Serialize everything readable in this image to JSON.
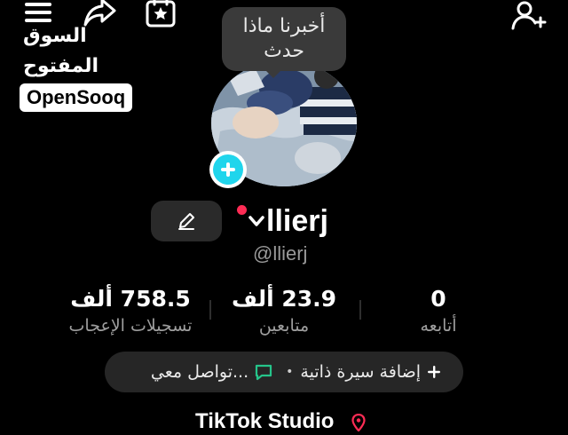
{
  "header": {
    "icons": [
      "menu-icon",
      "share-icon",
      "calendar-star-icon",
      "add-user-icon"
    ]
  },
  "watermark": {
    "arabic_name": "السوق المفتوح",
    "brand": "OpenSooq"
  },
  "bubble": {
    "line1": "أخبرنا ماذا",
    "line2": "حدث"
  },
  "profile": {
    "display_name": "llierj",
    "handle": "@llierj"
  },
  "stats": {
    "likes_value": "758.5 ألف",
    "likes_label": "تسجيلات الإعجاب",
    "followers_value": "23.9 ألف",
    "followers_label": "متابعين",
    "following_value": "0",
    "following_label": "أتابعه"
  },
  "bio": {
    "add_bio": "إضافة سيرة ذاتية",
    "contact": "تواصل معي..."
  },
  "studio": {
    "label": "TikTok Studio"
  },
  "colors": {
    "background": "#000000",
    "accent_cyan": "#20d5ec",
    "notification_red": "#fe2c55",
    "contact_icon_green": "#25c48a",
    "pill_bg": "#262626"
  }
}
